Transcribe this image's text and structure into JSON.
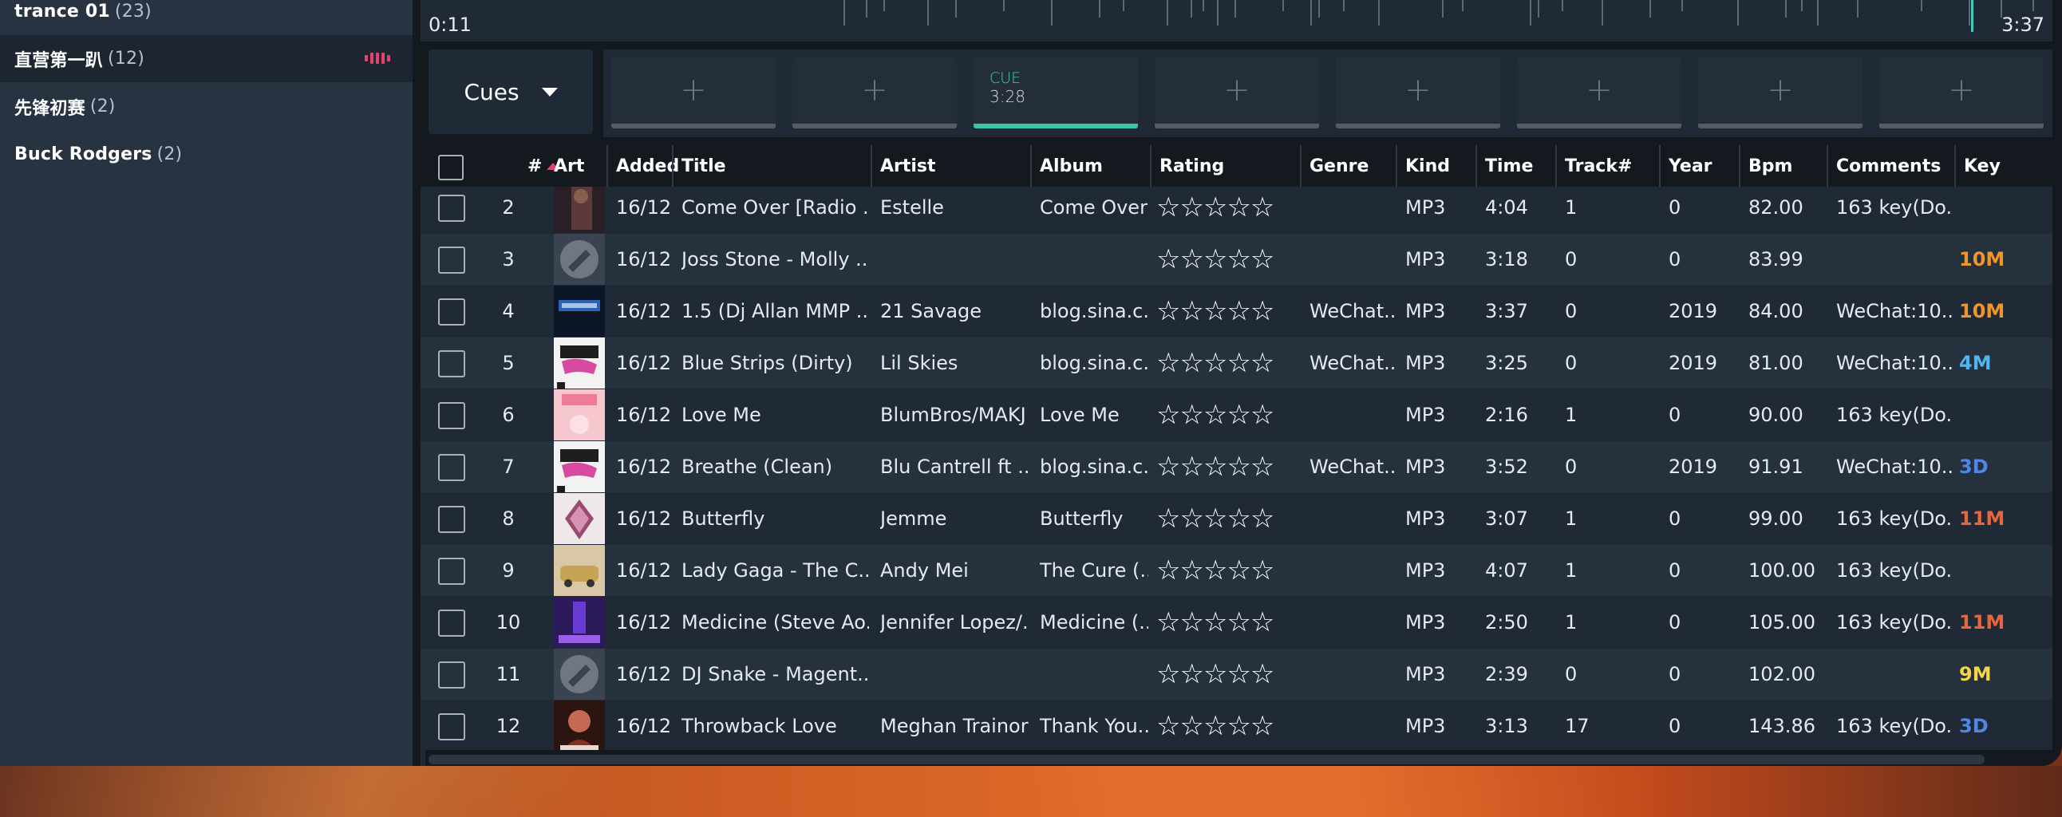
{
  "sidebar": {
    "items": [
      {
        "name": "trance 01",
        "count": "(23)",
        "active": false
      },
      {
        "name": "直营第一趴",
        "count": "(12)",
        "active": true,
        "playing": true
      },
      {
        "name": "先锋初赛",
        "count": "(2)",
        "active": false
      },
      {
        "name": "Buck Rodgers",
        "count": "(2)",
        "active": false
      }
    ]
  },
  "player": {
    "elapsed": "0:11",
    "total": "3:37",
    "progress": 0.051
  },
  "cues": {
    "select_label": "Cues",
    "pads": [
      {
        "label": "+",
        "set": false
      },
      {
        "label": "+",
        "set": false
      },
      {
        "label": "CUE",
        "time": "3:28",
        "set": true
      },
      {
        "label": "+",
        "set": false
      },
      {
        "label": "+",
        "set": false
      },
      {
        "label": "+",
        "set": false
      },
      {
        "label": "+",
        "set": false
      },
      {
        "label": "+",
        "set": false
      }
    ]
  },
  "table": {
    "columns": [
      "#",
      "Art",
      "Added",
      "Title",
      "Artist",
      "Album",
      "Rating",
      "Genre",
      "Kind",
      "Time",
      "Track#",
      "Year",
      "Bpm",
      "Comments",
      "Key"
    ],
    "sort_column": "#",
    "sort_direction": "ascending",
    "rows": [
      {
        "num": "2",
        "added": "16/12/...",
        "title": "Come Over [Radio ...",
        "artist": "Estelle",
        "album": "Come Over",
        "rating": "☆☆☆☆☆",
        "genre": "",
        "kind": "MP3",
        "time": "4:04",
        "track": "1",
        "year": "0",
        "bpm": "82.00",
        "comments": "163 key(Do...",
        "key": "",
        "key_color": "#ffffff",
        "art": "dark-portrait"
      },
      {
        "num": "3",
        "added": "16/12/...",
        "title": "Joss Stone - Molly ...",
        "artist": "",
        "album": "",
        "rating": "☆☆☆☆☆",
        "genre": "",
        "kind": "MP3",
        "time": "3:18",
        "track": "0",
        "year": "0",
        "bpm": "83.99",
        "comments": "",
        "key": "10M",
        "key_color": "#f0952a",
        "art": "placeholder"
      },
      {
        "num": "4",
        "added": "16/12/...",
        "title": "1.5 (Dj Allan MMP ...",
        "artist": "21 Savage",
        "album": "blog.sina.c...",
        "rating": "☆☆☆☆☆",
        "genre": "WeChat...",
        "kind": "MP3",
        "time": "3:37",
        "track": "0",
        "year": "2019",
        "bpm": "84.00",
        "comments": "WeChat:10...",
        "key": "10M",
        "key_color": "#f0952a",
        "art": "dark-blue"
      },
      {
        "num": "5",
        "added": "16/12/...",
        "title": "Blue Strips (Dirty)",
        "artist": "Lil Skies",
        "album": "blog.sina.c...",
        "rating": "☆☆☆☆☆",
        "genre": "WeChat...",
        "kind": "MP3",
        "time": "3:25",
        "track": "0",
        "year": "2019",
        "bpm": "81.00",
        "comments": "WeChat:10...",
        "key": "4M",
        "key_color": "#4fb6f0",
        "art": "white-logo"
      },
      {
        "num": "6",
        "added": "16/12/...",
        "title": "Love Me",
        "artist": "BlumBros/MAKJ",
        "album": "Love Me",
        "rating": "☆☆☆☆☆",
        "genre": "",
        "kind": "MP3",
        "time": "2:16",
        "track": "1",
        "year": "0",
        "bpm": "90.00",
        "comments": "163 key(Do...",
        "key": "",
        "key_color": "#ffffff",
        "art": "pink"
      },
      {
        "num": "7",
        "added": "16/12/...",
        "title": "Breathe (Clean)",
        "artist": "Blu Cantrell ft ...",
        "album": "blog.sina.c...",
        "rating": "☆☆☆☆☆",
        "genre": "WeChat...",
        "kind": "MP3",
        "time": "3:52",
        "track": "0",
        "year": "2019",
        "bpm": "91.91",
        "comments": "WeChat:10...",
        "key": "3D",
        "key_color": "#4f86e8",
        "art": "white-logo"
      },
      {
        "num": "8",
        "added": "16/12/...",
        "title": "Butterfly",
        "artist": "Jemme",
        "album": "Butterfly",
        "rating": "☆☆☆☆☆",
        "genre": "",
        "kind": "MP3",
        "time": "3:07",
        "track": "1",
        "year": "0",
        "bpm": "99.00",
        "comments": "163 key(Do...",
        "key": "11M",
        "key_color": "#e8663a",
        "art": "diamond"
      },
      {
        "num": "9",
        "added": "16/12/...",
        "title": "Lady Gaga - The C...",
        "artist": "Andy Mei",
        "album": "The Cure (...",
        "rating": "☆☆☆☆☆",
        "genre": "",
        "kind": "MP3",
        "time": "4:07",
        "track": "1",
        "year": "0",
        "bpm": "100.00",
        "comments": "163 key(Do...",
        "key": "",
        "key_color": "#ffffff",
        "art": "car"
      },
      {
        "num": "10",
        "added": "16/12/...",
        "title": "Medicine (Steve Ao...",
        "artist": "Jennifer Lopez/...",
        "album": "Medicine (...",
        "rating": "☆☆☆☆☆",
        "genre": "",
        "kind": "MP3",
        "time": "2:50",
        "track": "1",
        "year": "0",
        "bpm": "105.00",
        "comments": "163 key(Do...",
        "key": "11M",
        "key_color": "#e8663a",
        "art": "purple"
      },
      {
        "num": "11",
        "added": "16/12/...",
        "title": "DJ Snake - Magent...",
        "artist": "",
        "album": "",
        "rating": "☆☆☆☆☆",
        "genre": "",
        "kind": "MP3",
        "time": "2:39",
        "track": "0",
        "year": "0",
        "bpm": "102.00",
        "comments": "",
        "key": "9M",
        "key_color": "#f2d54a",
        "art": "placeholder"
      },
      {
        "num": "12",
        "added": "16/12/...",
        "title": "Throwback Love",
        "artist": "Meghan Trainor",
        "album": "Thank You...",
        "rating": "☆☆☆☆☆",
        "genre": "",
        "kind": "MP3",
        "time": "3:13",
        "track": "17",
        "year": "0",
        "bpm": "143.86",
        "comments": "163 key(Do...",
        "key": "3D",
        "key_color": "#4f86e8",
        "art": "portrait"
      }
    ]
  }
}
